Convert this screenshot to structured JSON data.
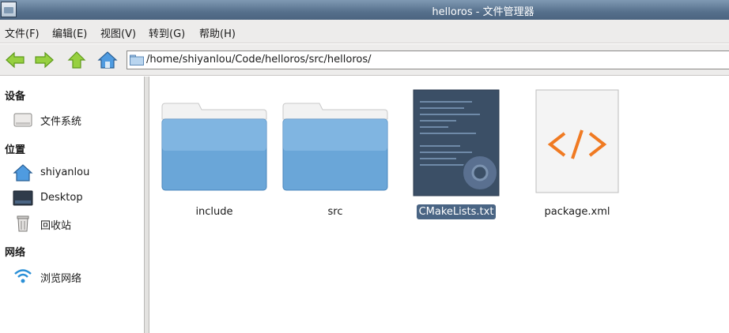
{
  "window": {
    "title": "helloros - 文件管理器",
    "icon": "file-manager-icon"
  },
  "menubar": {
    "items": [
      {
        "label": "文件(F)",
        "icon": null
      },
      {
        "label": "编辑(E)",
        "icon": null
      },
      {
        "label": "视图(V)",
        "icon": null
      },
      {
        "label": "转到(G)",
        "icon": null
      },
      {
        "label": "帮助(H)",
        "icon": null
      }
    ]
  },
  "toolbar": {
    "buttons": [
      {
        "name": "back-button",
        "icon": "arrow-left-icon"
      },
      {
        "name": "forward-button",
        "icon": "arrow-right-icon"
      },
      {
        "name": "up-button",
        "icon": "arrow-up-icon"
      },
      {
        "name": "home-button",
        "icon": "home-icon"
      }
    ],
    "path": "/home/shiyanlou/Code/helloros/src/helloros/"
  },
  "sidebar": {
    "sections": [
      {
        "title": "设备",
        "items": [
          {
            "label": "文件系统",
            "icon": "drive-icon"
          }
        ]
      },
      {
        "title": "位置",
        "items": [
          {
            "label": "shiyanlou",
            "icon": "home-icon"
          },
          {
            "label": "Desktop",
            "icon": "desktop-icon"
          },
          {
            "label": "回收站",
            "icon": "trash-icon"
          }
        ]
      },
      {
        "title": "网络",
        "items": [
          {
            "label": "浏览网络",
            "icon": "network-icon"
          }
        ]
      }
    ]
  },
  "files": [
    {
      "name": "include",
      "type": "folder",
      "selected": false
    },
    {
      "name": "src",
      "type": "folder",
      "selected": false
    },
    {
      "name": "CMakeLists.txt",
      "type": "script-file",
      "selected": true
    },
    {
      "name": "package.xml",
      "type": "xml-file",
      "selected": false
    }
  ],
  "colors": {
    "titlebar": "#56708c",
    "selection": "#4a6584",
    "folder": "#6aa6d8",
    "xml_accent": "#f07a22",
    "arrow_green": "#8fcc3a"
  }
}
